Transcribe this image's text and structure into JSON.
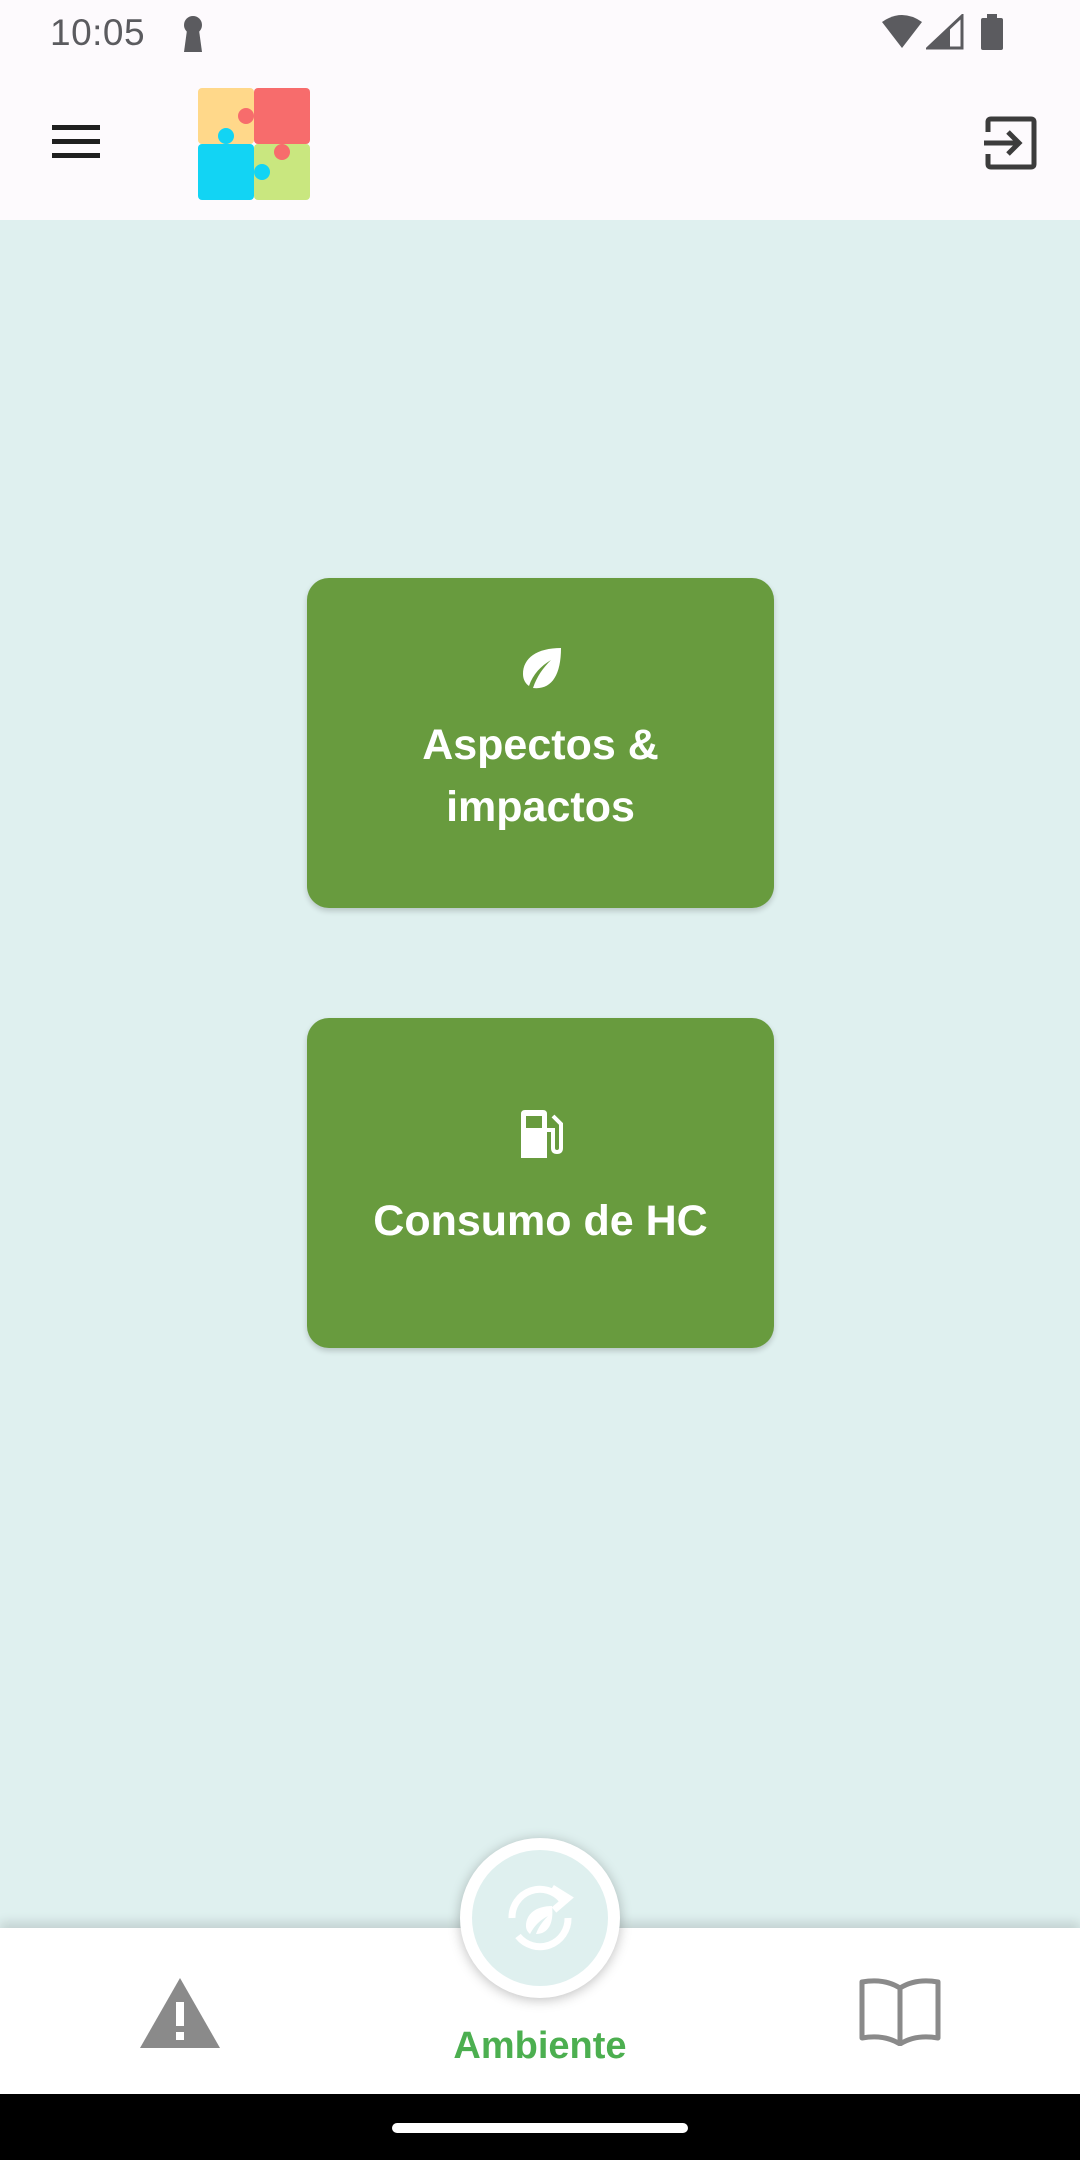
{
  "status_bar": {
    "time": "10:05"
  },
  "app_bar": {
    "menu_icon": "hamburger-menu-icon",
    "logo_icon": "puzzle-logo-icon",
    "logout_icon": "exit-icon"
  },
  "tiles": [
    {
      "label": "Aspectos & impactos",
      "icon": "leaf-icon"
    },
    {
      "label": "Consumo de HC",
      "icon": "fuel-pump-icon"
    }
  ],
  "bottom_nav": {
    "items": [
      {
        "icon": "warning-icon"
      },
      {
        "label": "Ambiente",
        "icon": "eco-recycle-icon",
        "active": true
      },
      {
        "icon": "book-icon"
      }
    ]
  },
  "colors": {
    "tile_bg": "#689b3e",
    "content_bg": "#dff0ef",
    "active_label": "#4caf50",
    "logo_yellow": "#ffd88a",
    "logo_red": "#f76c6c",
    "logo_cyan": "#12d4f4",
    "logo_green": "#c9e77f"
  }
}
